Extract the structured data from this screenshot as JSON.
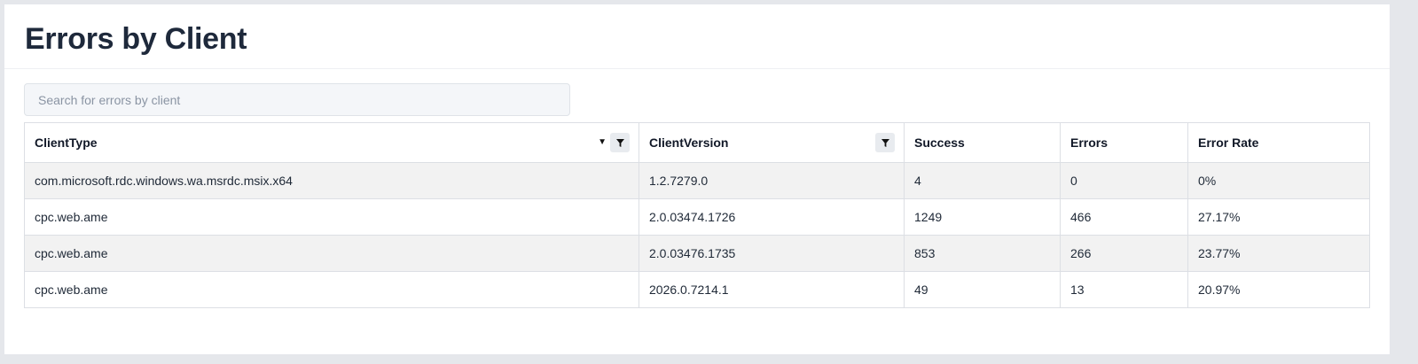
{
  "page": {
    "title": "Errors by Client",
    "search_placeholder": "Search for errors by client"
  },
  "table": {
    "columns": [
      {
        "label": "ClientType",
        "sortable": true,
        "filterable": true
      },
      {
        "label": "ClientVersion",
        "sortable": false,
        "filterable": true
      },
      {
        "label": "Success"
      },
      {
        "label": "Errors"
      },
      {
        "label": "Error Rate"
      }
    ],
    "rows": [
      [
        "com.microsoft.rdc.windows.wa.msrdc.msix.x64",
        "1.2.7279.0",
        "4",
        "0",
        "0%"
      ],
      [
        "cpc.web.ame",
        "2.0.03474.1726",
        "1249",
        "466",
        "27.17%"
      ],
      [
        "cpc.web.ame",
        "2.0.03476.1735",
        "853",
        "266",
        "23.77%"
      ],
      [
        "cpc.web.ame",
        "2026.0.7214.1",
        "49",
        "13",
        "20.97%"
      ]
    ]
  },
  "icons": {
    "sort": "caret-down-icon",
    "filter": "funnel-icon"
  }
}
